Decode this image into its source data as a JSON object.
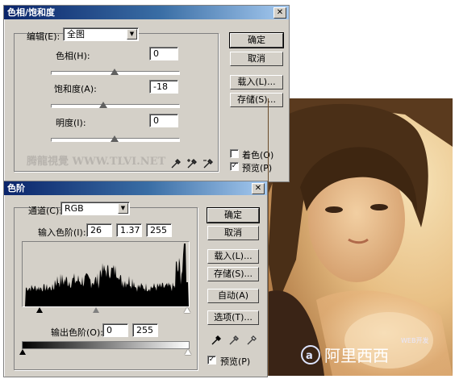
{
  "hue_sat_dialog": {
    "title": "色相/饱和度",
    "edit_label": "编辑(E):",
    "edit_value": "全图",
    "hue_label": "色相(H):",
    "hue_value": "0",
    "hue_level": 0.5,
    "sat_label": "饱和度(A):",
    "sat_value": "-18",
    "sat_level": 0.41,
    "light_label": "明度(I):",
    "light_value": "0",
    "light_level": 0.5,
    "ok": "确定",
    "cancel": "取消",
    "load": "载入(L)...",
    "save": "存储(S)...",
    "colorize": "着色(O)",
    "preview": "预览(P)",
    "watermark": "腾龍視覺 WWW.TLVI.NET"
  },
  "levels_dialog": {
    "title": "色阶",
    "channel_label": "通道(C):",
    "channel_value": "RGB",
    "input_label": "输入色阶(I):",
    "input_black": "26",
    "input_gamma": "1.37",
    "input_white": "255",
    "output_label": "输出色阶(O):",
    "output_black": "0",
    "output_white": "255",
    "ok": "确定",
    "cancel": "取消",
    "load": "载入(L)...",
    "save": "存储(S)...",
    "auto": "自动(A)",
    "options": "选项(T)...",
    "preview": "预览(P)"
  },
  "photo_watermark": {
    "small": "WEB开发",
    "brand": "阿里西西"
  },
  "colors": {
    "title_start": "#0a246a",
    "dialog_bg": "#d4d0c8"
  }
}
